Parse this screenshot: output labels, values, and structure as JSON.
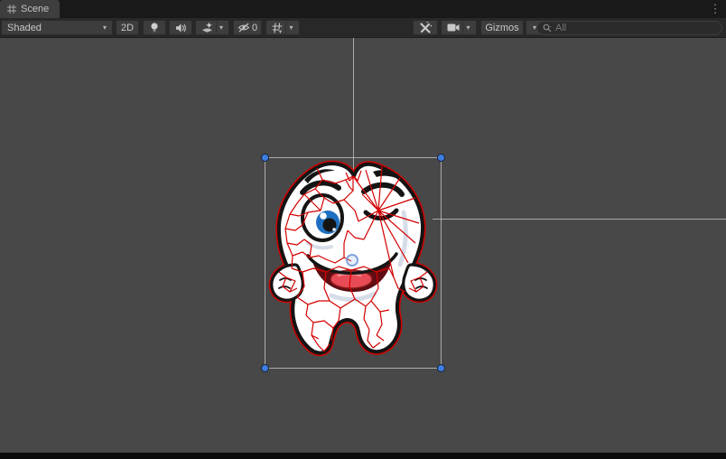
{
  "window": {
    "tab_label": "Scene",
    "more_menu": "⋮"
  },
  "toolbar": {
    "draw_mode_label": "Shaded",
    "toggle_2d_label": "2D",
    "hidden_object_count": "0",
    "gizmos_label": "Gizmos",
    "search_placeholder": "All",
    "dropdown_arrow": "▾",
    "icons": {
      "scene_tab": "grid-icon",
      "lighting": "lightbulb-icon",
      "audio": "speaker-icon",
      "effects": "effects-sparkle-icon",
      "visibility": "eye-slash-icon",
      "grid_toggle": "grid-toggle-icon",
      "tools": "wrench-screwdriver-icon",
      "camera": "video-camera-icon",
      "search": "magnifier-icon"
    }
  },
  "scene": {
    "selected_object": "tooth mascot sprite",
    "overlay": "red voronoi fracture wireframe",
    "selection_handle_count": 4,
    "colors": {
      "background": "#484848",
      "selection_handle_blue": "#3e7de0",
      "fracture_red": "#d40000",
      "guide_line_gray": "#a9a9a9",
      "sprite_outline": "#141414",
      "iris_blue": "#1e6fc0",
      "tongue_red": "#e84b55"
    }
  }
}
